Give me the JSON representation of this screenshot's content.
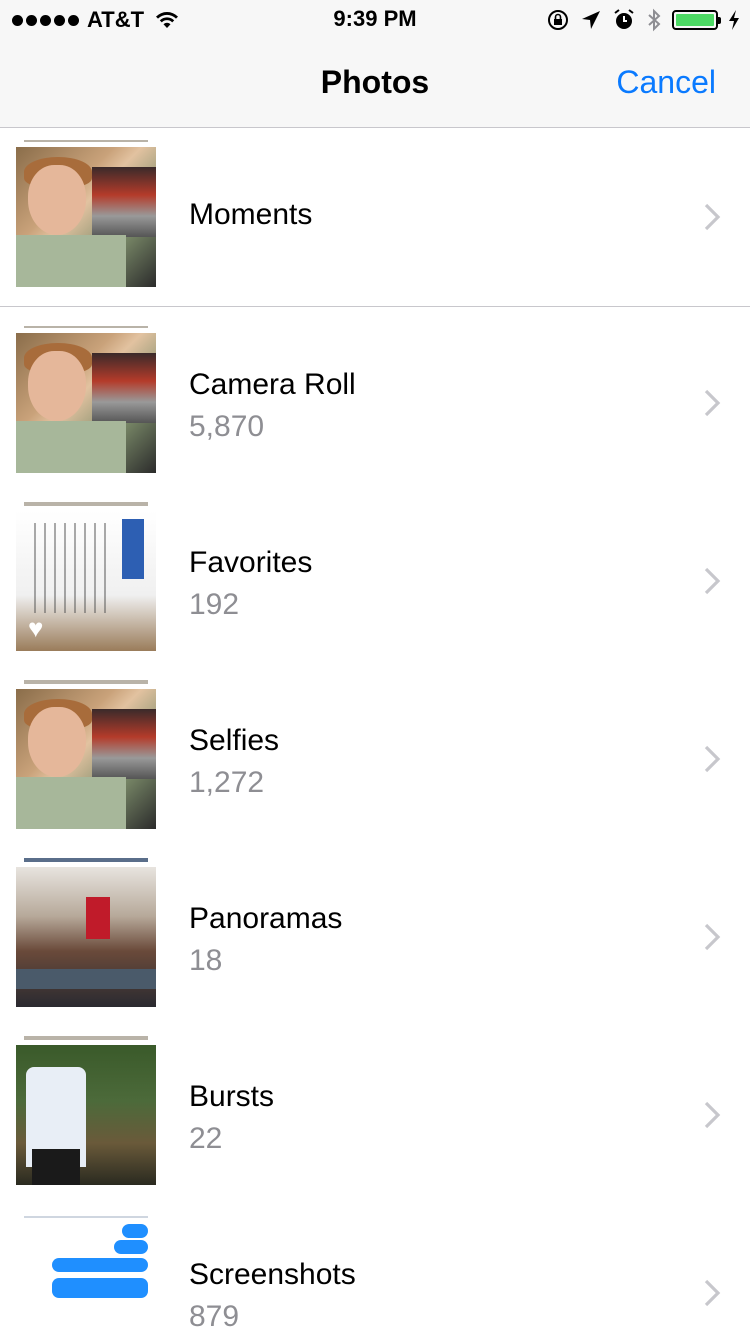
{
  "status_bar": {
    "carrier": "AT&T",
    "time": "9:39 PM",
    "battery_color": "#4cd964"
  },
  "nav": {
    "title": "Photos",
    "cancel_label": "Cancel",
    "accent": "#0a7aff"
  },
  "albums": [
    {
      "title": "Moments",
      "count": "",
      "thumb_icon": "selfie-photo"
    },
    {
      "title": "Camera Roll",
      "count": "5,870",
      "thumb_icon": "selfie-photo"
    },
    {
      "title": "Favorites",
      "count": "192",
      "thumb_icon": "document-photo"
    },
    {
      "title": "Selfies",
      "count": "1,272",
      "thumb_icon": "selfie-photo"
    },
    {
      "title": "Panoramas",
      "count": "18",
      "thumb_icon": "stage-photo"
    },
    {
      "title": "Bursts",
      "count": "22",
      "thumb_icon": "outdoor-photo"
    },
    {
      "title": "Screenshots",
      "count": "879",
      "thumb_icon": "messages-screenshot"
    }
  ],
  "colors": {
    "secondary_text": "#8e8e93",
    "separator": "#c8c7cc",
    "chevron": "#c7c7cc"
  }
}
